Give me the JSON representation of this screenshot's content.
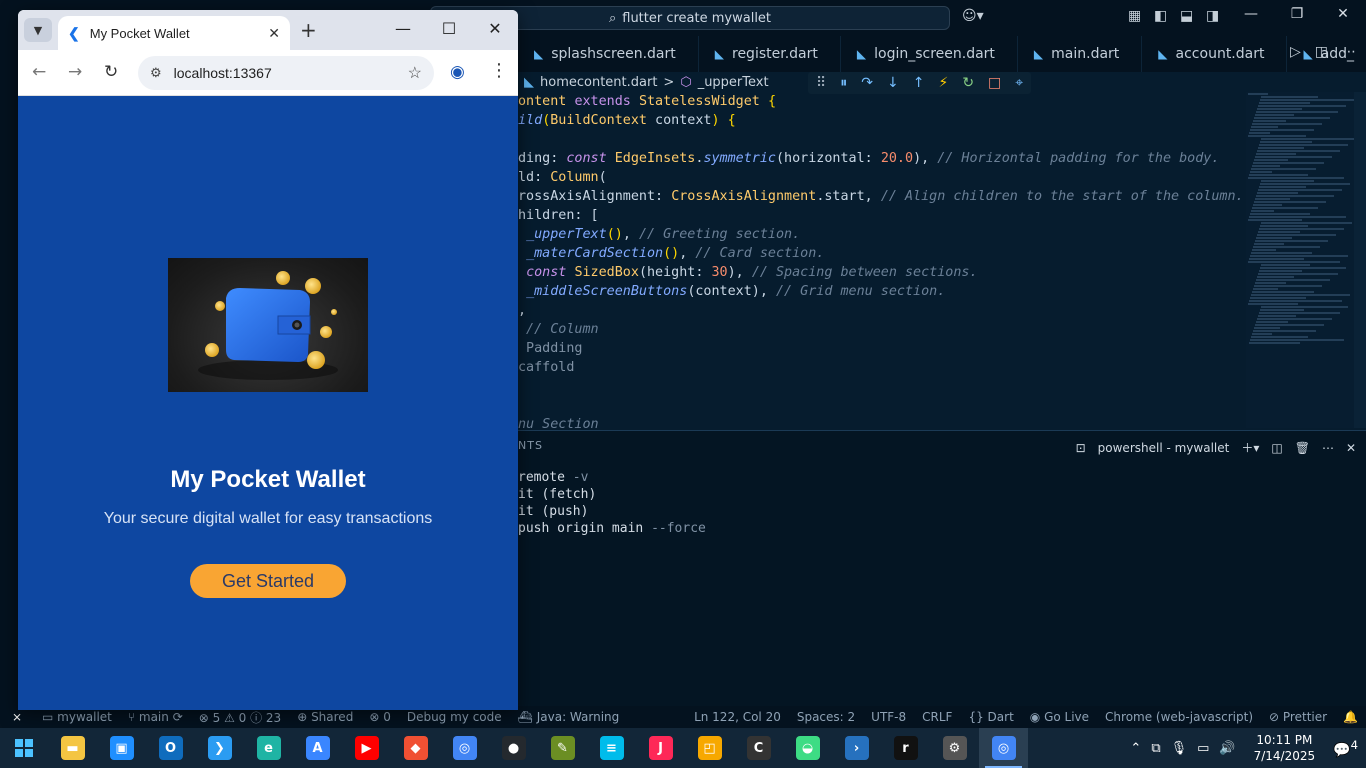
{
  "vscode": {
    "search_text": "flutter create mywallet",
    "tabs": [
      {
        "label": "splashscreen.dart"
      },
      {
        "label": "register.dart"
      },
      {
        "label": "login_screen.dart"
      },
      {
        "label": "main.dart"
      },
      {
        "label": "account.dart"
      },
      {
        "label": "add_"
      }
    ],
    "breadcrumb": {
      "file": "homecontent.dart",
      "sep": ">",
      "symbol": "_upperText"
    },
    "panel_header": "NTS",
    "terminal_title": "powershell - mywallet",
    "terminal_lines": [
      {
        "main": "remote ",
        "dim": "-v"
      },
      {
        "main": "it (fetch)",
        "dim": ""
      },
      {
        "main": "it (push)",
        "dim": ""
      },
      {
        "main": "push origin main ",
        "dim": "--force"
      }
    ],
    "status": {
      "branch_repo": "mywallet",
      "branch": "main",
      "problems": "⊗ 5 ⚠ 0 ⓘ 23",
      "shared": "Shared",
      "ports": "0",
      "debug": "Debug my code",
      "java": "Java: Warning",
      "position": "Ln 122, Col 20",
      "spaces": "Spaces: 2",
      "encoding": "UTF-8",
      "eol": "CRLF",
      "language": "{} Dart",
      "golive": "Go Live",
      "device": "Chrome (web-javascript)",
      "prettier": "Prettier"
    }
  },
  "chrome": {
    "tab_title": "My Pocket Wallet",
    "url": "localhost:13367"
  },
  "app": {
    "title": "My Pocket Wallet",
    "subtitle": "Your secure digital wallet for easy transactions",
    "cta_label": "Get Started"
  },
  "taskbar": {
    "time": "10:11 PM",
    "date": "7/14/2025",
    "notifications": "4",
    "apps": [
      {
        "icon": "file-explorer-icon",
        "color": "#f4c542"
      },
      {
        "icon": "microsoft-store-icon",
        "color": "#1f8fff"
      },
      {
        "icon": "outlook-icon",
        "color": "#0f6cbd"
      },
      {
        "icon": "vscode-icon",
        "color": "#2b9cf2"
      },
      {
        "icon": "edge-icon",
        "color": "#1fb4a4"
      },
      {
        "icon": "android-studio-icon",
        "color": "#3a86ff"
      },
      {
        "icon": "youtube-icon",
        "color": "#ff0000"
      },
      {
        "icon": "git-client-icon",
        "color": "#f05033"
      },
      {
        "icon": "chrome-icon",
        "color": "#4285f4"
      },
      {
        "icon": "github-icon",
        "color": "#24292e"
      },
      {
        "icon": "tool-icon",
        "color": "#6b8e23"
      },
      {
        "icon": "cisco-icon",
        "color": "#00bceb"
      },
      {
        "icon": "jetbrains-icon",
        "color": "#fe2857"
      },
      {
        "icon": "app-icon",
        "color": "#f7a800"
      },
      {
        "icon": "cybrary-icon",
        "color": "#333333"
      },
      {
        "icon": "android-icon",
        "color": "#3ddc84"
      },
      {
        "icon": "powershell-icon",
        "color": "#2671be"
      },
      {
        "icon": "r-icon",
        "color": "#111111"
      },
      {
        "icon": "settings-icon",
        "color": "#555555"
      },
      {
        "icon": "chrome-active-icon",
        "color": "#4285f4"
      }
    ]
  },
  "colors": {
    "app_bg": "#0e47a1",
    "cta_bg": "#f9a533",
    "vscode_bg": "#061c2e"
  }
}
